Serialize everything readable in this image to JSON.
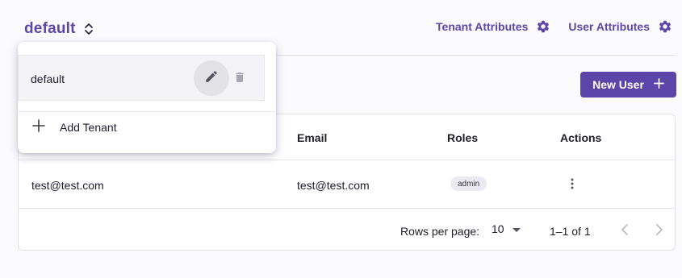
{
  "header": {
    "tenant_name": "default",
    "tenant_attributes_label": "Tenant Attributes",
    "user_attributes_label": "User Attributes"
  },
  "actions": {
    "new_user_label": "New User"
  },
  "table": {
    "columns": [
      "Email",
      "Roles",
      "Actions"
    ],
    "rows": [
      {
        "name": "test@test.com",
        "email": "test@test.com",
        "role": "admin"
      }
    ],
    "rows_per_page_label": "Rows per page:",
    "rows_per_page_value": "10",
    "range_label": "1–1 of 1"
  },
  "tenant_menu": {
    "items": [
      {
        "label": "default"
      }
    ],
    "add_label": "Add Tenant"
  },
  "icons": {
    "tenant_switch": "unfold-more-icon",
    "settings": "gear-icon",
    "add": "plus-icon",
    "edit": "pencil-icon",
    "delete": "trash-icon",
    "row_actions": "more-vertical-icon",
    "dropdown": "caret-down-icon",
    "prev": "chevron-left-icon",
    "next": "chevron-right-icon"
  },
  "colors": {
    "accent": "#5c44a9",
    "page_bg": "#fbfbfe",
    "chip_bg": "#ebeaf0"
  }
}
